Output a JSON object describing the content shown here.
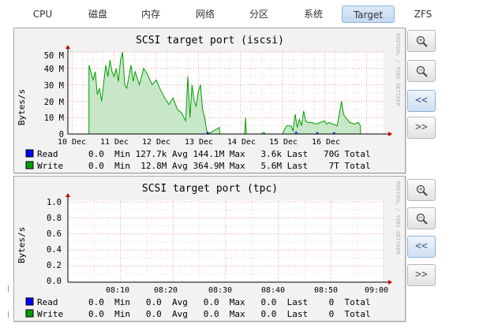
{
  "tabs": [
    {
      "label": "CPU"
    },
    {
      "label": "磁盘"
    },
    {
      "label": "内存"
    },
    {
      "label": "网络"
    },
    {
      "label": "分区"
    },
    {
      "label": "系统"
    },
    {
      "label": "Target",
      "active": true
    },
    {
      "label": "ZFS"
    }
  ],
  "side_buttons": {
    "zoom_in": "+",
    "zoom_out": "−",
    "back": "<<",
    "forward": ">>"
  },
  "colors": {
    "read": "#0000ff",
    "write": "#00a000",
    "write_fill": "#c8e6c8",
    "accent": "#cc0000"
  },
  "charts": [
    {
      "watermark": "RRDTOOL / TOBI OETIKER",
      "legend": [
        {
          "name": "Read",
          "stats": "0.0  Min 127.7k Avg 144.1M Max   3.6k Last   70G Total"
        },
        {
          "name": "Write",
          "stats": "0.0  Min  12.8M Avg 364.9M Max   5.6M Last    7T Total"
        }
      ]
    },
    {
      "watermark": "RRDTOOL / TOBI OETIKER",
      "legend": [
        {
          "name": "Read",
          "stats": "0.0  Min   0.0  Avg   0.0  Max   0.0  Last    0  Total"
        },
        {
          "name": "Write",
          "stats": "0.0  Min   0.0  Avg   0.0  Max   0.0  Last    0  Total"
        }
      ]
    }
  ],
  "chart_data": [
    {
      "type": "area",
      "title": "SCSI target port (iscsi)",
      "ylabel": "Bytes/s",
      "xlabel": "",
      "y_ticks": [
        "0",
        "10 M",
        "20 M",
        "30 M",
        "40 M",
        "50 M"
      ],
      "x_ticks": [
        "10 Dec",
        "11 Dec",
        "12 Dec",
        "13 Dec",
        "14 Dec",
        "15 Dec",
        "16 Dec"
      ],
      "ylim": [
        0,
        50
      ],
      "y_unit": "M",
      "grid": true,
      "series": [
        {
          "name": "Write",
          "points": [
            [
              10.4,
              0
            ],
            [
              10.4,
              42
            ],
            [
              10.5,
              33
            ],
            [
              10.55,
              38
            ],
            [
              10.6,
              24
            ],
            [
              10.65,
              28
            ],
            [
              10.7,
              20
            ],
            [
              10.8,
              42
            ],
            [
              10.85,
              35
            ],
            [
              10.9,
              45
            ],
            [
              10.95,
              38
            ],
            [
              11.0,
              35
            ],
            [
              11.05,
              40
            ],
            [
              11.1,
              32
            ],
            [
              11.15,
              45
            ],
            [
              11.2,
              50
            ],
            [
              11.25,
              30
            ],
            [
              11.3,
              28
            ],
            [
              11.4,
              42
            ],
            [
              11.45,
              32
            ],
            [
              11.5,
              38
            ],
            [
              11.6,
              30
            ],
            [
              11.7,
              40
            ],
            [
              11.8,
              36
            ],
            [
              11.9,
              30
            ],
            [
              12.0,
              33
            ],
            [
              12.1,
              27
            ],
            [
              12.2,
              22
            ],
            [
              12.3,
              18
            ],
            [
              12.4,
              22
            ],
            [
              12.5,
              15
            ],
            [
              12.6,
              13
            ],
            [
              12.7,
              8
            ],
            [
              12.75,
              35
            ],
            [
              12.8,
              10
            ],
            [
              12.85,
              30
            ],
            [
              12.9,
              20
            ],
            [
              12.95,
              17
            ],
            [
              13.0,
              26
            ],
            [
              13.05,
              30
            ],
            [
              13.1,
              15
            ],
            [
              13.15,
              10
            ],
            [
              13.2,
              2
            ],
            [
              13.22,
              0
            ],
            [
              13.3,
              1
            ],
            [
              13.5,
              4
            ],
            [
              13.51,
              0
            ],
            [
              14.1,
              0
            ],
            [
              14.12,
              10
            ],
            [
              14.14,
              0
            ],
            [
              14.5,
              0
            ],
            [
              14.55,
              1
            ],
            [
              14.6,
              0
            ],
            [
              15.0,
              0
            ],
            [
              15.05,
              3
            ],
            [
              15.1,
              5
            ],
            [
              15.2,
              5
            ],
            [
              15.25,
              2
            ],
            [
              15.3,
              12
            ],
            [
              15.35,
              4
            ],
            [
              15.4,
              9
            ],
            [
              15.45,
              5
            ],
            [
              15.5,
              14
            ],
            [
              15.55,
              8
            ],
            [
              15.6,
              7
            ],
            [
              15.7,
              7
            ],
            [
              15.8,
              6
            ],
            [
              15.9,
              7
            ],
            [
              16.0,
              8
            ],
            [
              16.05,
              6
            ],
            [
              16.1,
              7
            ],
            [
              16.2,
              6
            ],
            [
              16.3,
              5
            ],
            [
              16.4,
              20
            ],
            [
              16.45,
              12
            ],
            [
              16.5,
              10
            ],
            [
              16.6,
              7
            ],
            [
              16.7,
              6
            ],
            [
              16.8,
              7
            ],
            [
              16.85,
              5
            ],
            [
              16.85,
              0
            ]
          ]
        },
        {
          "name": "Read",
          "points": [
            [
              10.4,
              0
            ],
            [
              13.2,
              0
            ],
            [
              13.22,
              1.2
            ],
            [
              13.26,
              0
            ],
            [
              15.3,
              0
            ],
            [
              15.32,
              1.3
            ],
            [
              15.36,
              0
            ],
            [
              15.8,
              0
            ],
            [
              15.82,
              1.0
            ],
            [
              15.86,
              0
            ],
            [
              16.2,
              0
            ],
            [
              16.22,
              1.0
            ],
            [
              16.26,
              0
            ],
            [
              16.85,
              0
            ]
          ]
        }
      ]
    },
    {
      "type": "line",
      "title": "SCSI target port (tpc)",
      "ylabel": "Bytes/s",
      "xlabel": "",
      "y_ticks": [
        "0.0",
        "0.2",
        "0.4",
        "0.6",
        "0.8",
        "1.0"
      ],
      "x_ticks": [
        "08:10",
        "08:20",
        "08:30",
        "08:40",
        "08:50",
        "09:00"
      ],
      "ylim": [
        0,
        1.0
      ],
      "grid": true,
      "series": [
        {
          "name": "Read",
          "points": [
            [
              8.0,
              0
            ],
            [
              9.0,
              0
            ]
          ]
        },
        {
          "name": "Write",
          "points": [
            [
              8.0,
              0
            ],
            [
              9.0,
              0
            ]
          ]
        }
      ]
    }
  ]
}
